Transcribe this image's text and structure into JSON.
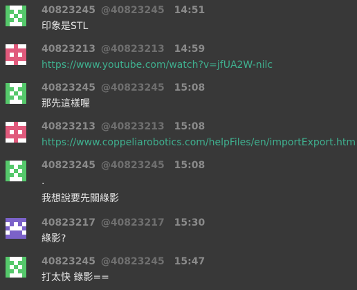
{
  "colors": {
    "background": "#383838",
    "text": "#e6e6e6",
    "meta": "#8a8a8a",
    "link": "#3fb08f",
    "avatar_green": "#55c86b",
    "avatar_red": "#e05a7c",
    "avatar_purple": "#7b62c9"
  },
  "messages": [
    {
      "avatar_icon": "green-identicon",
      "username": "40823245",
      "handle": "@40823245",
      "time": "14:51",
      "lines": [
        "印象是STL"
      ]
    },
    {
      "avatar_icon": "red-identicon",
      "username": "40823213",
      "handle": "@40823213",
      "time": "14:59",
      "lines": [
        "https://www.youtube.com/watch?v=jfUA2W-nilc"
      ]
    },
    {
      "avatar_icon": "green-identicon",
      "username": "40823245",
      "handle": "@40823245",
      "time": "15:08",
      "lines": [
        "那先這樣喔"
      ]
    },
    {
      "avatar_icon": "red-identicon",
      "username": "40823213",
      "handle": "@40823213",
      "time": "15:08",
      "lines": [
        "https://www.coppeliarobotics.com/helpFiles/en/importExport.htm"
      ]
    },
    {
      "avatar_icon": "green-identicon",
      "username": "40823245",
      "handle": "@40823245",
      "time": "15:08",
      "lines": [
        ".",
        "我想說要先關綠影"
      ]
    },
    {
      "avatar_icon": "purple-identicon",
      "username": "40823217",
      "handle": "@40823217",
      "time": "15:30",
      "lines": [
        "綠影?"
      ]
    },
    {
      "avatar_icon": "green-identicon",
      "username": "40823245",
      "handle": "@40823245",
      "time": "15:47",
      "lines": [
        "打太快 錄影=="
      ]
    }
  ]
}
